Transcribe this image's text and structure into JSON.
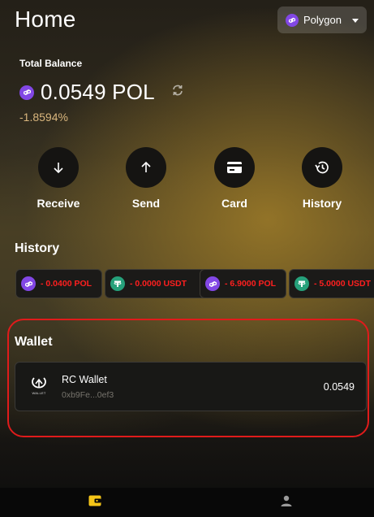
{
  "header": {
    "title": "Home",
    "network": "Polygon"
  },
  "balance": {
    "label": "Total Balance",
    "value": "0.0549 POL",
    "change": "-1.8594%"
  },
  "actions": [
    {
      "label": "Receive",
      "icon": "arrow-down-icon"
    },
    {
      "label": "Send",
      "icon": "arrow-up-icon"
    },
    {
      "label": "Card",
      "icon": "card-icon"
    },
    {
      "label": "History",
      "icon": "history-icon"
    }
  ],
  "history": {
    "title": "History",
    "items": [
      {
        "text": "- 0.0400 POL",
        "token": "polygon"
      },
      {
        "text": "- 0.0000 USDT",
        "token": "tether"
      },
      {
        "text": "- 6.9000 POL",
        "token": "polygon"
      },
      {
        "text": "- 5.0000 USDT",
        "token": "tether"
      }
    ]
  },
  "wallet": {
    "title": "Wallet",
    "name": "RC Wallet",
    "address": "0xb9Fe...0ef3",
    "balance": "0.0549",
    "logo_text": "WALLET"
  },
  "nav": {
    "items": [
      {
        "icon": "wallet-icon",
        "active": true
      },
      {
        "icon": "profile-icon",
        "active": false
      }
    ]
  },
  "colors": {
    "accent": "#f5c518",
    "negative": "#ff1f1f",
    "highlight": "#e01b1b",
    "polygon": "#8247e5",
    "tether": "#26a17b"
  }
}
